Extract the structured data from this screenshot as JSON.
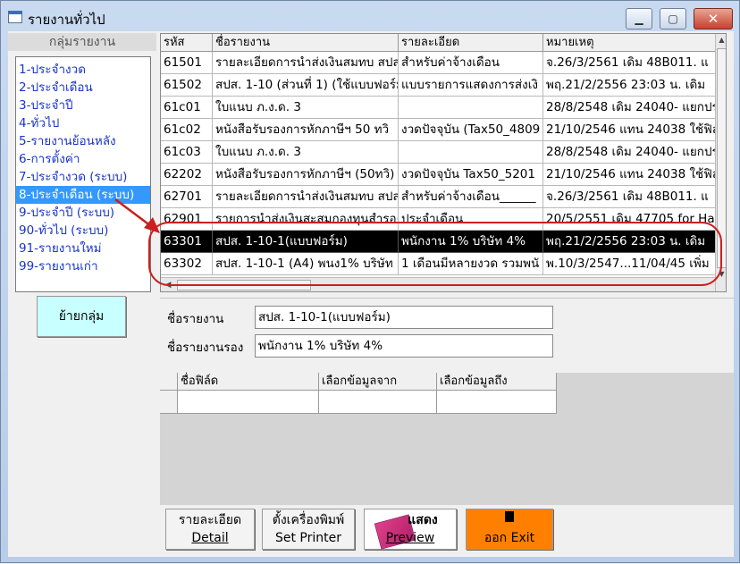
{
  "window": {
    "title": "รายงานทั่วไป",
    "minimize_icon": "minimize-icon",
    "maximize_icon": "maximize-icon",
    "close_icon": "close-icon"
  },
  "groups": {
    "header": "กลุ่มรายงาน",
    "items": [
      "1-ประจำงวด",
      "2-ประจำเดือน",
      "3-ประจำปี",
      "4-ทั่วไป",
      "5-รายงานย้อนหลัง",
      "6-การตั้งค่า",
      "7-ประจำงวด (ระบบ)",
      "8-ประจำเดือน (ระบบ)",
      "9-ประจำปี (ระบบ)",
      "90-ทั่วไป (ระบบ)",
      "91-รายงานใหม่",
      "99-รายงานเก่า"
    ],
    "selected_index": 7,
    "move_button": "ย้ายกลุ่ม"
  },
  "report_grid": {
    "columns": [
      "รหัส",
      "ชื่อรายงาน",
      "รายละเอียด",
      "หมายเหตุ"
    ],
    "rows": [
      [
        "61501",
        "รายละเอียดการนำส่งเงินสมทบ สปส",
        "สำหรับค่าจ้างเดือน",
        "จ.26/3/2561  เดิม 48B011. แ"
      ],
      [
        "61502",
        "สปส. 1-10 (ส่วนที่ 1) (ใช้แบบฟอร์ม",
        "แบบรายการแสดงการส่งเงิ",
        "พฤ.21/2/2556  23:03 น. เดิม"
      ],
      [
        "61c01",
        "ใบแนบ ภ.ง.ด. 3",
        "",
        "28/8/2548 เดิม 24040- แยกปร"
      ],
      [
        "61c02",
        "หนังสือรับรองการหักภาษีฯ 50 ทวิ",
        "งวดปัจจุบัน (Tax50_4809",
        "21/10/2546 แทน 24038 ใช้ฟิล"
      ],
      [
        "61c03",
        "ใบแนบ ภ.ง.ด. 3",
        "",
        "28/8/2548 เดิม 24040- แยกปร"
      ],
      [
        "62202",
        "หนังสือรับรองการหักภาษีฯ (50ทวิ)",
        "งวดปัจจุบัน Tax50_5201",
        "21/10/2546 แทน 24038 ใช้ฟิล"
      ],
      [
        "62701",
        "รายละเอียดการนำส่งเงินสมทบ สปส",
        "สำหรับค่าจ้างเดือน______",
        "จ.26/3/2561  เดิม 48B011. แ"
      ],
      [
        "62901",
        "รายการนำส่งเงินสะสมกองทุนสำรอง",
        "ประจำเดือน",
        "20/5/2551 เดิม 47705 for Ha"
      ],
      [
        "63301",
        "สปส. 1-10-1(แบบฟอร์ม)",
        "พนักงาน 1% บริษัท 4%",
        "พฤ.21/2/2556  23:03 น. เดิม"
      ],
      [
        "63302",
        "สปส. 1-10-1 (A4) พนง1% บริษัท",
        "1 เดือนมีหลายงวด รวมพนั",
        "พ.10/3/2547...11/04/45 เพิ่ม"
      ]
    ],
    "selected_index": 8
  },
  "detail": {
    "name_label": "ชื่อรายงาน",
    "name_value": "สปส. 1-10-1(แบบฟอร์ม)",
    "subname_label": "ชื่อรายงานรอง",
    "subname_value": "พนักงาน 1% บริษัท 4%"
  },
  "field_grid": {
    "columns": [
      "ชื่อฟิล์ด",
      "เลือกข้อมูลจาก",
      "เลือกข้อมูลถึง"
    ]
  },
  "buttons": {
    "detail_line1": "รายละเอียด",
    "detail_line2": "Detail",
    "printer_line1": "ตั้งเครื่องพิมพ์",
    "printer_line2": "Set Printer",
    "preview_line1": "แสดง",
    "preview_line2": "Preview",
    "exit_label": "ออก  Exit"
  },
  "annotation": {
    "color": "#cc1f1f"
  }
}
